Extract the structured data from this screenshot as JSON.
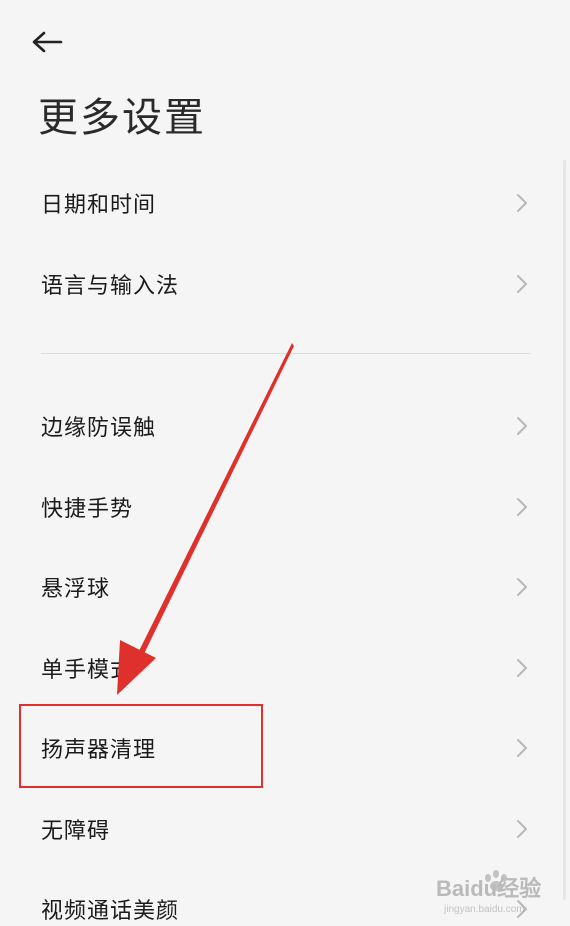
{
  "header": {
    "back_icon": "arrow-left-icon",
    "title": "更多设置"
  },
  "settings": {
    "group1": [
      {
        "label": "日期和时间"
      },
      {
        "label": "语言与输入法"
      }
    ],
    "group2": [
      {
        "label": "边缘防误触"
      },
      {
        "label": "快捷手势"
      },
      {
        "label": "悬浮球"
      },
      {
        "label": "单手模式"
      },
      {
        "label": "扬声器清理"
      },
      {
        "label": "无障碍"
      },
      {
        "label": "视频通话美颜"
      }
    ]
  },
  "annotation": {
    "color": "#e0302b",
    "highlighted_item": "扬声器清理"
  },
  "watermark": {
    "text": "Baidu经验",
    "subtext": "jingyan.baidu.com"
  }
}
